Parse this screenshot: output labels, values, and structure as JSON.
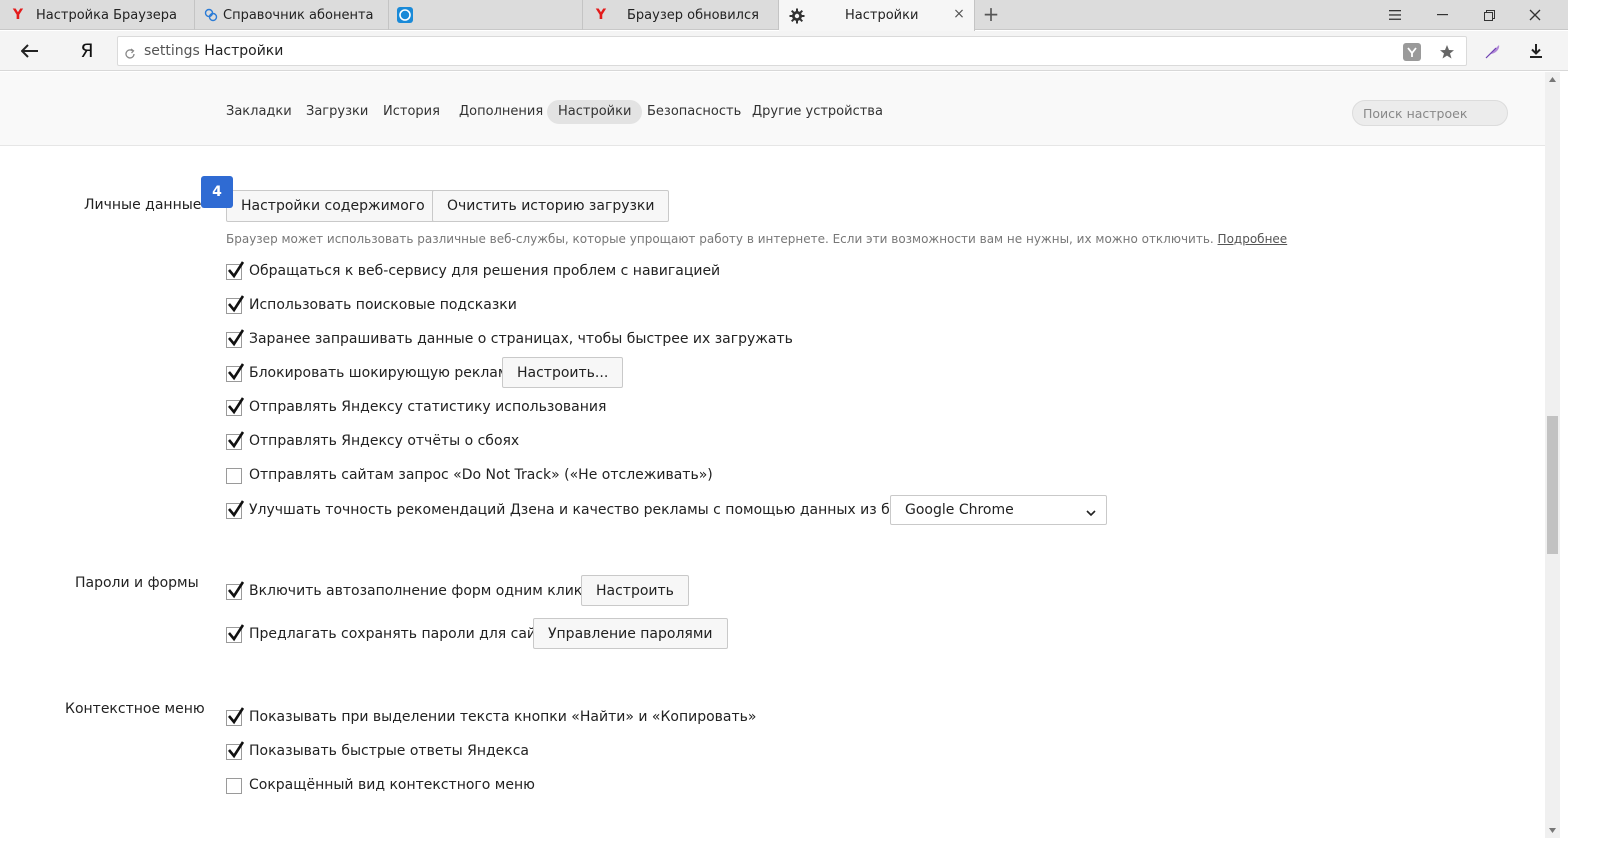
{
  "tabs": [
    {
      "label": "Настройка Браузера",
      "icon": "yandex-icon"
    },
    {
      "label": "Справочник абонента",
      "icon": "globe-icon"
    },
    {
      "label": "",
      "icon": "skype-icon"
    },
    {
      "label": "Браузер обновился",
      "icon": "yandex-icon"
    },
    {
      "label": "Настройки",
      "icon": "gear-icon"
    }
  ],
  "toolbar": {
    "home_label": "Я",
    "url_proto": "settings",
    "url_title": "Настройки"
  },
  "settings_nav": {
    "items": [
      "Закладки",
      "Загрузки",
      "История",
      "Дополнения",
      "Настройки",
      "Безопасность",
      "Другие устройства"
    ],
    "active": "Настройки",
    "search_placeholder": "Поиск настроек"
  },
  "personal": {
    "label": "Личные данные",
    "badge": "4",
    "content_button": "Настройки содержимого",
    "clear_button": "Очистить историю загрузки",
    "hint": "Браузер может использовать различные веб-службы, которые упрощают работу в интернете. Если эти возможности вам не нужны, их можно отключить.",
    "hint_link": "Подробнее",
    "options": [
      {
        "label": "Обращаться к веб-сервису для решения проблем с навигацией",
        "checked": true
      },
      {
        "label": "Использовать поисковые подсказки",
        "checked": true
      },
      {
        "label": "Заранее запрашивать данные о страницах, чтобы быстрее их загружать",
        "checked": true
      },
      {
        "label": "Блокировать шокирующую рекламу",
        "checked": true,
        "button": "Настроить..."
      },
      {
        "label": "Отправлять Яндексу статистику использования",
        "checked": true
      },
      {
        "label": "Отправлять Яндексу отчёты о сбоях",
        "checked": true
      },
      {
        "label": "Отправлять сайтам запрос «Do Not Track» («Не отслеживать»)",
        "checked": false
      },
      {
        "label": "Улучшать точность рекомендаций Дзена и качество рекламы с помощью данных из браузера:",
        "checked": true,
        "select": "Google Chrome"
      }
    ]
  },
  "passwords": {
    "label": "Пароли и формы",
    "options": [
      {
        "label": "Включить автозаполнение форм одним кликом.",
        "checked": true,
        "button": "Настроить"
      },
      {
        "label": "Предлагать сохранять пароли для сайтов",
        "checked": true,
        "button": "Управление паролями"
      }
    ]
  },
  "context_menu": {
    "label": "Контекстное меню",
    "options": [
      {
        "label": "Показывать при выделении текста кнопки «Найти» и «Копировать»",
        "checked": true
      },
      {
        "label": "Показывать быстрые ответы Яндекса",
        "checked": true
      },
      {
        "label": "Сокращённый вид контекстного меню",
        "checked": false
      }
    ]
  },
  "colors": {
    "badge": "#2f6bd3",
    "yandex_red": "#e31b1b",
    "checkmark": "#111111"
  }
}
